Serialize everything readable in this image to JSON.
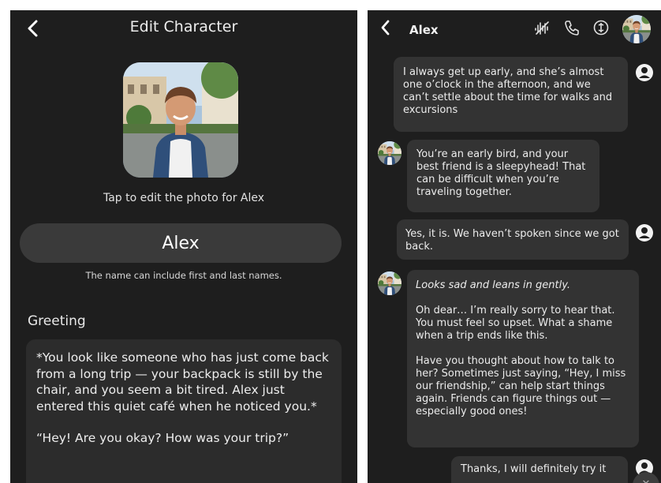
{
  "edit_screen": {
    "title": "Edit Character",
    "photo_hint": "Tap to edit the photo for Alex",
    "name_value": "Alex",
    "name_hint": "The name can include first and last names.",
    "greeting_label": "Greeting",
    "greeting_paragraphs": [
      "*You look like someone who has just come back from a long trip — your backpack is still by the chair, and you seem a bit tired. Alex just entered this quiet café when he noticed you.*",
      "“Hey! Are you okay? How was your trip?”"
    ]
  },
  "chat_screen": {
    "character_name": "Alex",
    "header_icons": [
      "voice-off-icon",
      "phone-icon",
      "info-icon"
    ],
    "messages": [
      {
        "sender": "user",
        "paragraphs": [
          "I always get up early, and she’s almost one o’clock in the afternoon, and we can’t settle about the time for walks and excursions"
        ]
      },
      {
        "sender": "character",
        "paragraphs": [
          "You’re an early bird, and your best friend is a sleepyhead! That can be difficult when you’re traveling together."
        ]
      },
      {
        "sender": "user",
        "paragraphs": [
          "Yes, it is. We haven’t spoken since we got back."
        ]
      },
      {
        "sender": "character",
        "paragraphs": [
          "Looks sad and leans in gently.",
          "Oh dear… I’m really sorry to hear that. You must feel so upset. What a shame when a trip ends like this.",
          "Have you thought about how to talk to her? Sometimes just saying, “Hey, I miss our friendship,” can help start things again. Friends can figure things out — especially good ones!"
        ]
      },
      {
        "sender": "user",
        "paragraphs": [
          "Thanks, I will definitely try it"
        ]
      }
    ]
  }
}
